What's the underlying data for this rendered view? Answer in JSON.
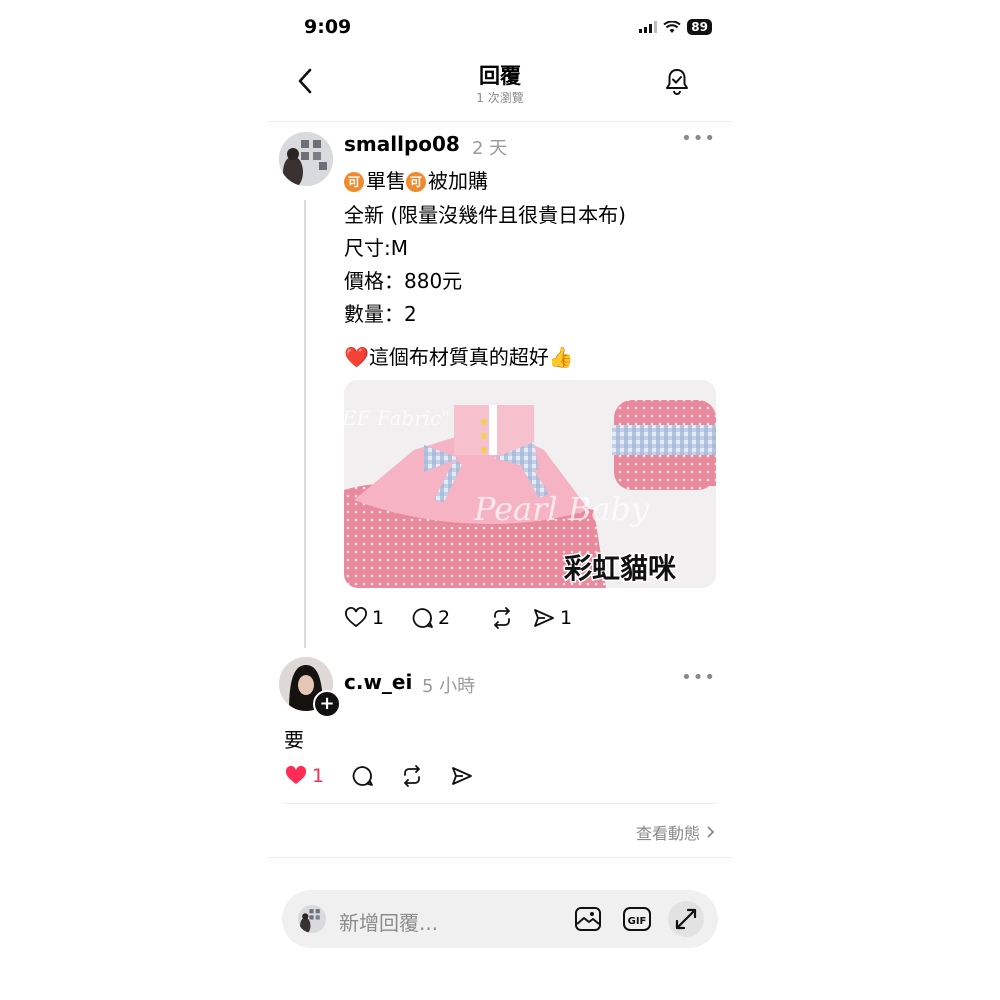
{
  "status": {
    "time": "9:09",
    "battery": "89"
  },
  "nav": {
    "title": "回覆",
    "subtitle": "1 次瀏覽"
  },
  "post": {
    "username": "smallpo08",
    "time": "2 天",
    "badge_char": "可",
    "line1_a": "單售",
    "line1_b": "被加購",
    "line2": "全新 (限量沒幾件且很貴日本布)",
    "line3": "尺寸:M",
    "line4": "價格：880元",
    "line5": "數量：2",
    "line6": "❤️這個布材質真的超好👍",
    "image_watermark_1": "EF Fabric\"",
    "image_watermark_2": "Pearl Baby",
    "image_tag": "彩虹貓咪",
    "likes": "1",
    "comments": "2",
    "shares": "1"
  },
  "reply": {
    "username": "c.w_ei",
    "time": "5 小時",
    "text": "要",
    "likes": "1"
  },
  "footer": {
    "view_activity": "查看動態"
  },
  "composer": {
    "placeholder": "新增回覆..."
  },
  "icons": [
    "back-arrow-icon",
    "bell-icon",
    "more-icon",
    "heart-icon",
    "comment-icon",
    "repost-icon",
    "send-icon",
    "chevron-right-icon",
    "image-icon",
    "gif-icon",
    "expand-icon",
    "plus-icon"
  ],
  "colors": {
    "like": "#ff2d55",
    "badge": "#f08a2e"
  }
}
